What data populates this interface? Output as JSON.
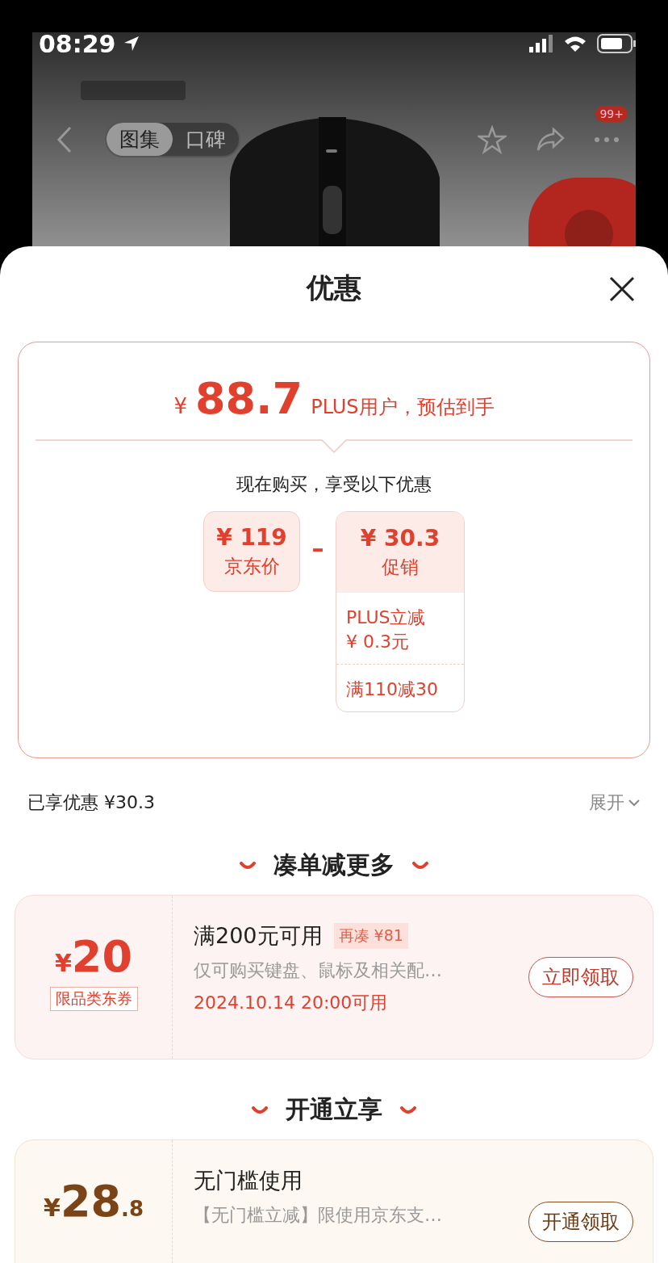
{
  "status_bar": {
    "time": "08:29"
  },
  "nav": {
    "tabs": [
      {
        "label": "图集",
        "selected": true
      },
      {
        "label": "口碑",
        "selected": false
      }
    ],
    "badge": "99+"
  },
  "sheet": {
    "title": "优惠",
    "price_card": {
      "currency": "¥",
      "price": "88.7",
      "caption": "PLUS用户，预估到手",
      "subtitle": "现在购买，享受以下优惠",
      "base": {
        "amount": "¥ 119",
        "label": "京东价"
      },
      "operator": "–",
      "discount": {
        "amount": "¥ 30.3",
        "label": "促销",
        "items": [
          {
            "lines": [
              "PLUS立减",
              "¥ 0.3元"
            ]
          },
          {
            "lines": [
              "满110减30"
            ]
          }
        ]
      }
    },
    "enjoyed": "已享优惠 ¥30.3",
    "expand": "展开",
    "sections": [
      {
        "heading": "凑单减更多",
        "coupons": [
          {
            "kind": "red",
            "currency": "¥",
            "amount": "20",
            "tag": "限品类东券",
            "title": "满200元可用",
            "badge": "再凑 ¥81",
            "desc": "仅可购买键盘、鼠标及相关配…",
            "note": "2024.10.14 20:00可用",
            "button": "立即领取"
          }
        ]
      },
      {
        "heading": "开通立享",
        "coupons": [
          {
            "kind": "gold",
            "currency": "¥",
            "amount": "28",
            "decimal": ".8",
            "title": "无门槛使用",
            "desc": "【无门槛立减】限使用京东支…",
            "button": "开通领取"
          }
        ]
      }
    ]
  }
}
